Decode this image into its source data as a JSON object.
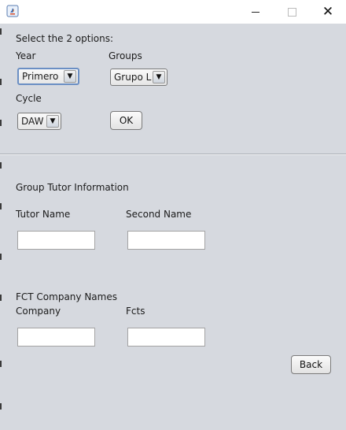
{
  "window": {
    "title": "",
    "icon": "java-icon",
    "controls": [
      "minimize-icon",
      "maximize-icon",
      "close-icon"
    ]
  },
  "selection": {
    "instruction": "Select the 2 options:",
    "year_label": "Year",
    "year_value": "Primero",
    "groups_label": "Groups",
    "groups_value": "Grupo L",
    "cycle_label": "Cycle",
    "cycle_value": "DAW",
    "ok_label": "OK"
  },
  "tutor": {
    "section_title": "Group Tutor Information",
    "tutor_name_label": "Tutor Name",
    "tutor_name_value": "",
    "second_name_label": "Second Name",
    "second_name_value": ""
  },
  "fct": {
    "section_title": "FCT Company Names",
    "company_label": "Company",
    "company_value": "",
    "fcts_label": "Fcts",
    "fcts_value": "",
    "back_label": "Back"
  },
  "colors": {
    "background": "#d6d9df",
    "titlebar": "#ffffff",
    "focus_border": "#6b8fc4"
  }
}
